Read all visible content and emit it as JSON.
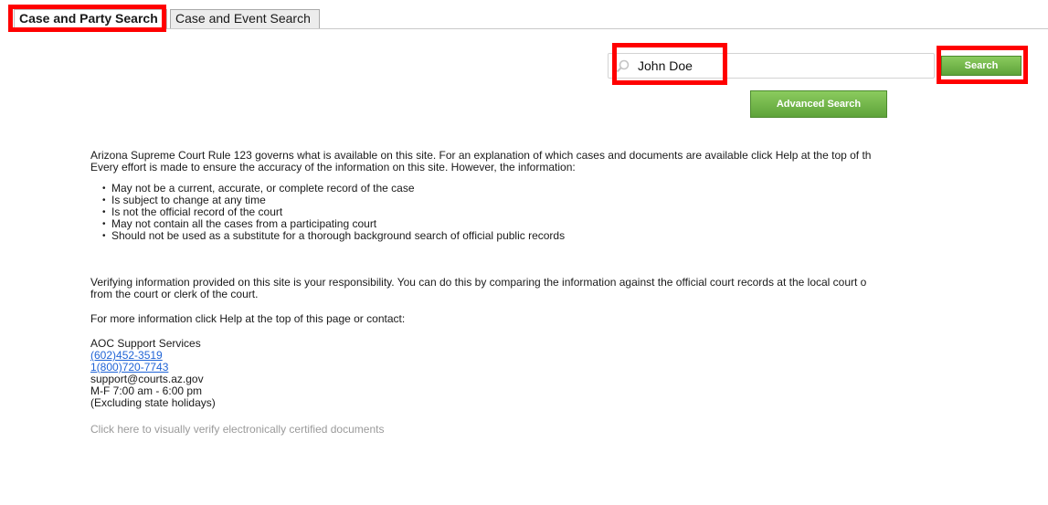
{
  "tabs": {
    "active": "Case and Party Search",
    "inactive": "Case and Event Search"
  },
  "search": {
    "value": "John Doe",
    "button_label": "Search",
    "advanced_label": "Advanced Search"
  },
  "content": {
    "intro_line1": "Arizona Supreme Court Rule 123 governs what is available on this site. For an explanation of which cases and documents are available click Help at the top of th",
    "intro_line2": "Every effort is made to ensure the accuracy of the information on this site. However, the information:",
    "bullets": [
      "May not be a current, accurate, or complete record of the case",
      "Is subject to change at any time",
      "Is not the official record of the court",
      "May not contain all the cases from a participating court",
      "Should not be used as a substitute for a thorough background search of official public records"
    ],
    "verify_line1": "Verifying information provided on this site is your responsibility. You can do this by comparing the information against the official court records at the local court o",
    "verify_line2": "from the court or clerk of the court.",
    "more_info": "For more information click Help at the top of this page or contact:",
    "contact": {
      "org": "AOC Support Services",
      "phone1": "(602)452-3519",
      "phone2": "1(800)720-7743",
      "email": "support@courts.az.gov",
      "hours": "M-F 7:00 am - 6:00 pm",
      "note": "(Excluding state holidays)"
    },
    "verify_docs_link": "Click here to visually verify electronically certified documents"
  },
  "colors": {
    "highlight": "#ff0000",
    "button_green": "#6bb042",
    "link_blue": "#1f63d6",
    "muted_link": "#9a9a9a"
  }
}
